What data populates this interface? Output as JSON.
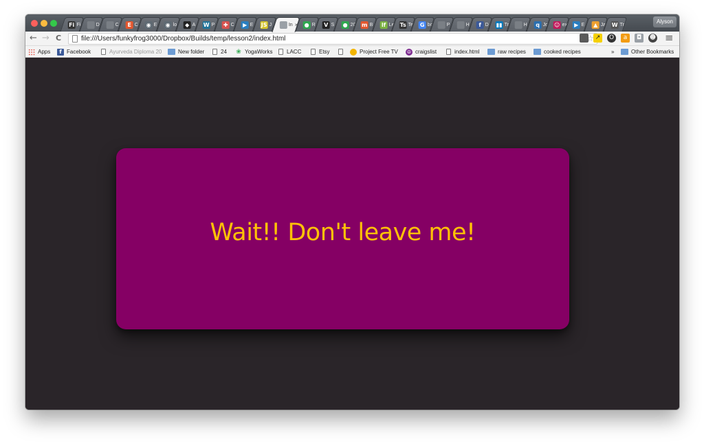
{
  "window": {
    "tabs": [
      {
        "title": "Fi",
        "favicon": "Fi",
        "color": "#333333"
      },
      {
        "title": "D",
        "favicon": "",
        "color": "#7a7f85"
      },
      {
        "title": "C",
        "favicon": "",
        "color": "#7a7f85"
      },
      {
        "title": "C",
        "favicon": "E",
        "color": "#e4572e"
      },
      {
        "title": "E",
        "favicon": "◉",
        "color": "#5f6a73"
      },
      {
        "title": "lo",
        "favicon": "◉",
        "color": "#5f6a73"
      },
      {
        "title": "A",
        "favicon": "◆",
        "color": "#222222"
      },
      {
        "title": "P",
        "favicon": "W",
        "color": "#21759b"
      },
      {
        "title": "C",
        "favicon": "✚",
        "color": "#d9534f"
      },
      {
        "title": "E",
        "favicon": "▶",
        "color": "#2a7fc1"
      },
      {
        "title": "J",
        "favicon": "JS",
        "color": "#d6c62a"
      },
      {
        "title": "In",
        "favicon": "",
        "color": "#9aa0a6"
      },
      {
        "title": "R",
        "favicon": "●",
        "color": "#2fa84f"
      },
      {
        "title": "S",
        "favicon": "V",
        "color": "#222222"
      },
      {
        "title": "20",
        "favicon": "●",
        "color": "#2fa84f"
      },
      {
        "title": "B",
        "favicon": "m",
        "color": "#e4572e"
      },
      {
        "title": "Le",
        "favicon": "lf",
        "color": "#7cb342"
      },
      {
        "title": "Te",
        "favicon": "Ts",
        "color": "#333333"
      },
      {
        "title": "bo",
        "favicon": "G",
        "color": "#4285f4"
      },
      {
        "title": "P",
        "favicon": "",
        "color": "#7a7f85"
      },
      {
        "title": "H",
        "favicon": "",
        "color": "#7a7f85"
      },
      {
        "title": "D",
        "favicon": "f",
        "color": "#3b5998"
      },
      {
        "title": "Tr",
        "favicon": "▮▮",
        "color": "#0079bf"
      },
      {
        "title": "H",
        "favicon": "",
        "color": "#7a7f85"
      },
      {
        "title": "Jc",
        "favicon": "q",
        "color": "#2a6fb0"
      },
      {
        "title": "ex",
        "favicon": "☺",
        "color": "#c2185b"
      },
      {
        "title": "E",
        "favicon": "▶",
        "color": "#2a7fc1"
      },
      {
        "title": "Ja",
        "favicon": "▲",
        "color": "#f0a030"
      },
      {
        "title": "Tr",
        "favicon": "W",
        "color": "#555555"
      }
    ],
    "active_tab_title": "In",
    "active_tab_close": "×",
    "profile_name": "Alyson"
  },
  "toolbar": {
    "back": "←",
    "forward": "→",
    "reload": "C",
    "url": "file:///Users/funkyfrog3000/Dropbox/Builds/temp/lesson2/index.html",
    "bookmark_star": "☆",
    "menu": "≡"
  },
  "bookmarks": {
    "items": [
      {
        "label": "Apps",
        "icon": "apps-icon"
      },
      {
        "label": "Facebook",
        "icon": "facebook-icon"
      },
      {
        "label": "Ayurveda Diploma 20",
        "icon": "page-icon"
      },
      {
        "label": "New folder",
        "icon": "folder-icon"
      },
      {
        "label": "24",
        "icon": "page-icon"
      },
      {
        "label": "YogaWorks",
        "icon": "leaf-icon"
      },
      {
        "label": "LACC",
        "icon": "page-icon"
      },
      {
        "label": "Etsy",
        "icon": "page-icon"
      },
      {
        "label": "",
        "icon": "page-icon"
      },
      {
        "label": "Project Free TV",
        "icon": "tv-icon"
      },
      {
        "label": "craigslist",
        "icon": "peace-icon"
      },
      {
        "label": "index.html",
        "icon": "page-icon"
      },
      {
        "label": "raw recipes",
        "icon": "folder-icon"
      },
      {
        "label": "cooked recipes",
        "icon": "folder-icon"
      }
    ],
    "overflow": "»",
    "other_bookmarks": "Other Bookmarks"
  },
  "page": {
    "background": "#2a2529",
    "dialog_color": "#850064",
    "message": "Wait!! Don't leave me!",
    "message_color": "#ffc107"
  }
}
